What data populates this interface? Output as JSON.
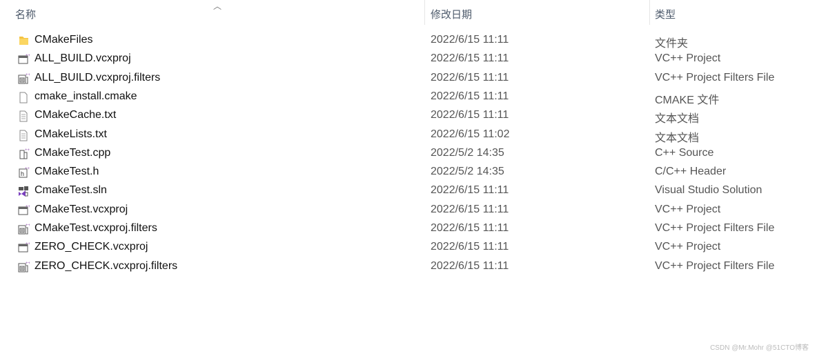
{
  "header": {
    "sort_icon": "chevron-up-icon",
    "name": "名称",
    "date": "修改日期",
    "type": "类型"
  },
  "files": [
    {
      "name": "CMakeFiles",
      "date": "2022/6/15 11:11",
      "type": "文件夹",
      "icon": "folder"
    },
    {
      "name": "ALL_BUILD.vcxproj",
      "date": "2022/6/15 11:11",
      "type": "VC++ Project",
      "icon": "vcxproj"
    },
    {
      "name": "ALL_BUILD.vcxproj.filters",
      "date": "2022/6/15 11:11",
      "type": "VC++ Project Filters File",
      "icon": "filters"
    },
    {
      "name": "cmake_install.cmake",
      "date": "2022/6/15 11:11",
      "type": "CMAKE 文件",
      "icon": "blank"
    },
    {
      "name": "CMakeCache.txt",
      "date": "2022/6/15 11:11",
      "type": "文本文档",
      "icon": "text"
    },
    {
      "name": "CMakeLists.txt",
      "date": "2022/6/15 11:02",
      "type": "文本文档",
      "icon": "text"
    },
    {
      "name": "CMakeTest.cpp",
      "date": "2022/5/2 14:35",
      "type": "C++ Source",
      "icon": "cpp"
    },
    {
      "name": "CMakeTest.h",
      "date": "2022/5/2 14:35",
      "type": "C/C++ Header",
      "icon": "header"
    },
    {
      "name": "CmakeTest.sln",
      "date": "2022/6/15 11:11",
      "type": "Visual Studio Solution",
      "icon": "sln"
    },
    {
      "name": "CMakeTest.vcxproj",
      "date": "2022/6/15 11:11",
      "type": "VC++ Project",
      "icon": "vcxproj"
    },
    {
      "name": "CMakeTest.vcxproj.filters",
      "date": "2022/6/15 11:11",
      "type": "VC++ Project Filters File",
      "icon": "filters"
    },
    {
      "name": "ZERO_CHECK.vcxproj",
      "date": "2022/6/15 11:11",
      "type": "VC++ Project",
      "icon": "vcxproj"
    },
    {
      "name": "ZERO_CHECK.vcxproj.filters",
      "date": "2022/6/15 11:11",
      "type": "VC++ Project Filters File",
      "icon": "filters"
    }
  ],
  "watermark": "CSDN @Mr.Mohr @51CTO博客",
  "colors": {
    "folder": "#f5c342",
    "plus": "#9b5fb5",
    "vs": "#7a3fbf"
  }
}
